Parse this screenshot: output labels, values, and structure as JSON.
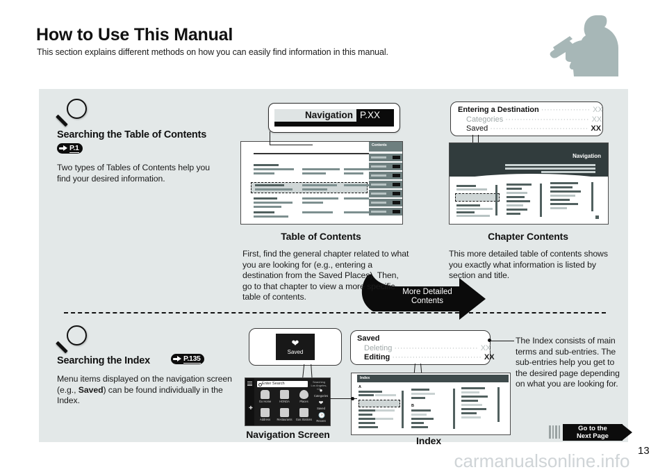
{
  "header": {
    "title": "How to Use This Manual",
    "subtitle": "This section explains different methods on how you can easily find information in this manual."
  },
  "section_toc": {
    "heading": "Searching the Table of Contents",
    "page_ref": "P.1",
    "body": "Two types of Tables of Contents help you find your desired information.",
    "nav_banner": {
      "label": "Navigation",
      "page": "P.XX"
    },
    "arrow_label": "More Detailed\nContents",
    "arrow_label_line1": "More Detailed",
    "arrow_label_line2": "Contents",
    "toc_caption": "Table of Contents",
    "toc_text": "First, find the general chapter related to what you are looking for (e.g., entering a destination from the Saved Places). Then, go to that chapter to view a more specific table of contents.",
    "chapter_caption": "Chapter Contents",
    "chapter_text": "This more detailed table of contents shows you exactly what information is listed by section and title.",
    "callout": {
      "lines": [
        {
          "name": "Entering a Destination",
          "page": "XX",
          "muted": false,
          "bold": true
        },
        {
          "name": "Categories",
          "page": "XX",
          "muted": true,
          "bold": false
        },
        {
          "name": "Saved",
          "page": "XX",
          "muted": false,
          "bold": false
        }
      ]
    },
    "thumb_tab_label": "Contents",
    "chapter_thumb_header": "Navigation"
  },
  "section_index": {
    "heading": "Searching the Index",
    "page_ref": "P.135",
    "body_pre": "Menu items displayed on the navigation screen (e.g., ",
    "body_bold": "Saved",
    "body_post": ") can be found individually in the Index.",
    "saved_tile": {
      "icon": "heart-icon",
      "label": "Saved"
    },
    "nav_screen_caption": "Navigation Screen",
    "index_caption": "Index",
    "index_thumb_header": "Index",
    "index_letters": [
      "A",
      "B"
    ],
    "callout": {
      "lines": [
        {
          "name": "Saved",
          "page": "",
          "muted": false,
          "bold": true
        },
        {
          "name": "Deleting",
          "page": "XX",
          "muted": true,
          "bold": false
        },
        {
          "name": "Editing",
          "page": "XX",
          "muted": false,
          "bold": true
        }
      ]
    },
    "side_text": "The Index consists of main terms and sub-entries. The sub-entries help you get to the desired page depending on what you are looking for.",
    "nav_screen": {
      "search_placeholder": "Enter Search",
      "location_line1": "Searching",
      "location_line2": "Los Angeles, CA",
      "tiles": [
        {
          "icon": "home-icon",
          "label": "Go Home"
        },
        {
          "icon": "honda-icon",
          "label": "HONDA"
        },
        {
          "icon": "pin-icon",
          "label": "Places"
        },
        {
          "icon": "address-icon",
          "label": "Address"
        },
        {
          "icon": "restaurant-icon",
          "label": "Restaurants"
        },
        {
          "icon": "fuel-icon",
          "label": "Gas Stations"
        }
      ],
      "rail": [
        {
          "icon": "pin-icon",
          "label": "Categories"
        },
        {
          "icon": "heart-icon",
          "label": "Saved"
        },
        {
          "icon": "clock-icon",
          "label": "Recent"
        }
      ]
    }
  },
  "footer": {
    "next_page_line1": "Go to the",
    "next_page_line2": "Next Page",
    "page_number": "13",
    "watermark": "carmanualsonline.info"
  },
  "colors": {
    "panel_bg": "#e3e8e8",
    "accent_dark": "#313c3d",
    "bar_gray": "#7d8f8f",
    "silhouette": "#a7b7b7"
  }
}
